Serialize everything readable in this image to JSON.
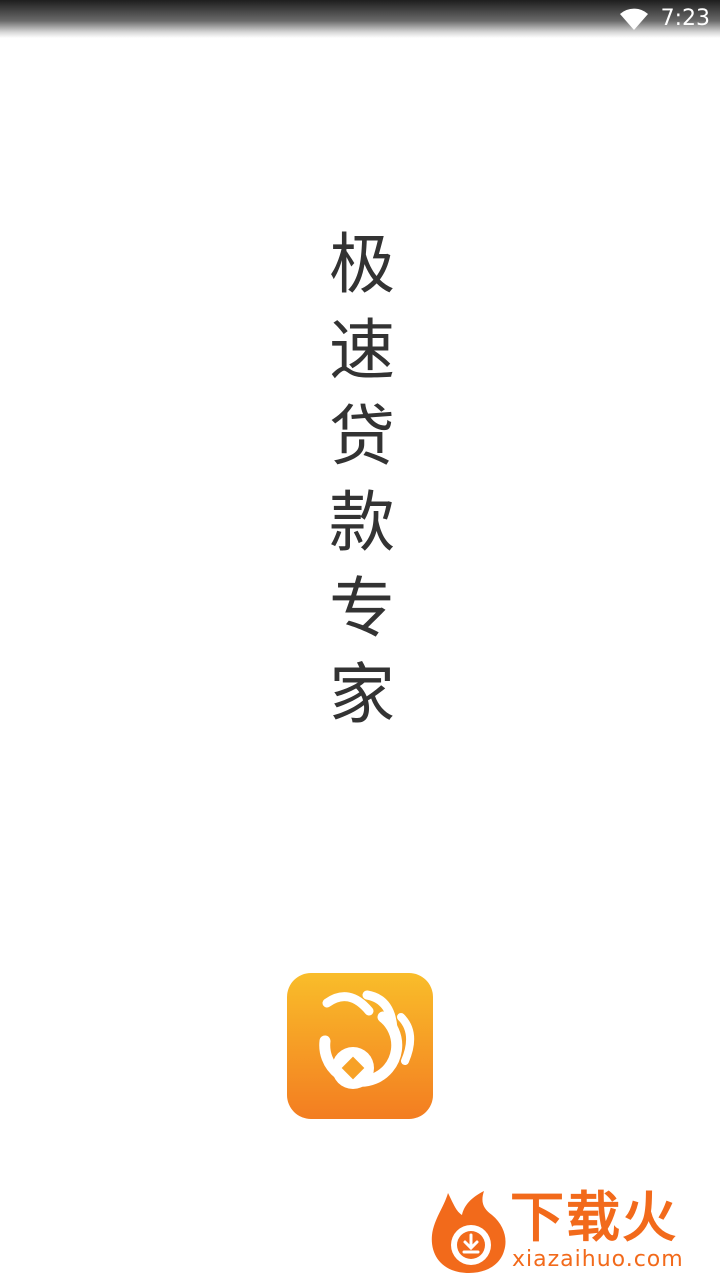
{
  "status_bar": {
    "time": "7:23",
    "wifi_icon": "wifi-icon"
  },
  "slogan": {
    "chars": [
      "极",
      "速",
      "贷",
      "款",
      "专",
      "家"
    ]
  },
  "app_logo": {
    "icon": "coin-hand-icon",
    "gradient_top": "#f9bd2a",
    "gradient_bottom": "#f37d21"
  },
  "watermark": {
    "icon": "flame-download-icon",
    "title": "下载火",
    "domain": "xiazaihuo.com",
    "color": "#f26a1b"
  }
}
